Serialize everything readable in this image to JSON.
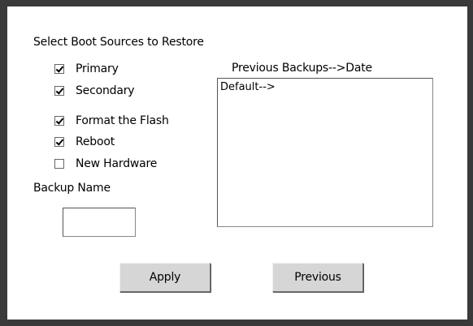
{
  "form": {
    "section_title": "Select Boot Sources to Restore",
    "options": [
      {
        "label": "Primary",
        "checked": true
      },
      {
        "label": "Secondary",
        "checked": true
      },
      {
        "label": "Format the Flash",
        "checked": true
      },
      {
        "label": "Reboot",
        "checked": true
      },
      {
        "label": "New Hardware",
        "checked": false
      }
    ],
    "backup_name_label": "Backup Name",
    "backup_name_value": ""
  },
  "backups": {
    "header": "Previous Backups-->Date",
    "items": [
      "Default-->"
    ]
  },
  "buttons": {
    "apply_label": "Apply",
    "previous_label": "Previous"
  }
}
